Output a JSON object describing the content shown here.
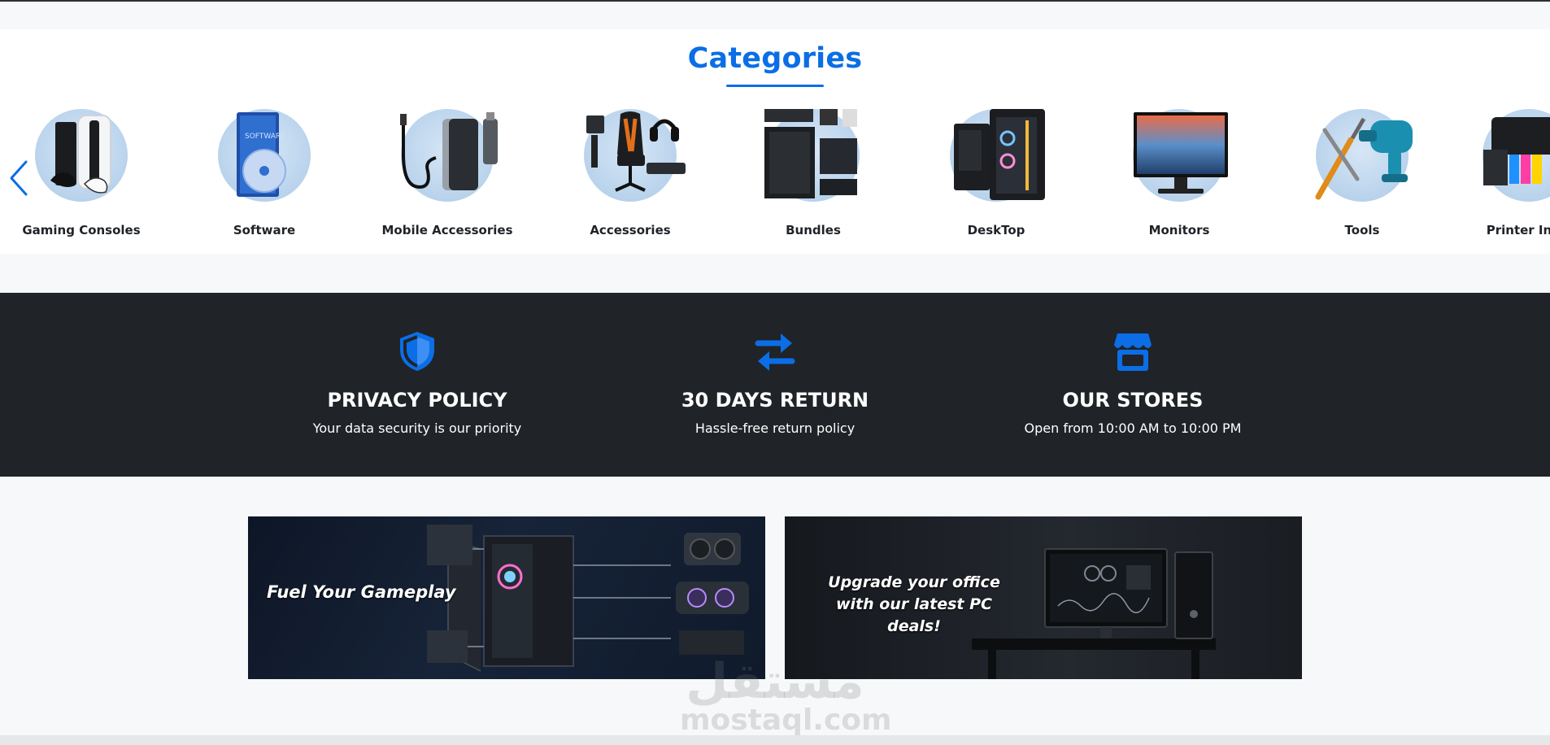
{
  "categories": {
    "title": "Categories",
    "items": [
      {
        "label": "Gaming Consoles",
        "icon": "console-icon"
      },
      {
        "label": "Software",
        "icon": "software-box-icon"
      },
      {
        "label": "Mobile Accessories",
        "icon": "powerbank-icon"
      },
      {
        "label": "Accessories",
        "icon": "gaming-chair-icon"
      },
      {
        "label": "Bundles",
        "icon": "pc-parts-icon"
      },
      {
        "label": "DeskTop",
        "icon": "desktop-tower-icon"
      },
      {
        "label": "Monitors",
        "icon": "monitor-icon"
      },
      {
        "label": "Tools",
        "icon": "tools-icon"
      },
      {
        "label": "Printer Ink c",
        "icon": "printer-ink-icon"
      }
    ]
  },
  "features": [
    {
      "title": "PRIVACY POLICY",
      "subtitle": "Your data security is our priority",
      "icon": "shield-icon"
    },
    {
      "title": "30 DAYS RETURN",
      "subtitle": "Hassle-free return policy",
      "icon": "swap-arrows-icon"
    },
    {
      "title": "OUR STORES",
      "subtitle": "Open from 10:00 AM to 10:00 PM",
      "icon": "store-icon"
    }
  ],
  "banners": [
    {
      "lines": [
        "Fuel Your Gameplay"
      ]
    },
    {
      "lines": [
        "Upgrade your office",
        "with our latest PC deals!"
      ]
    }
  ],
  "watermark": {
    "arabic": "مستقل",
    "latin": "mostaql.com"
  },
  "colors": {
    "accent": "#0b6ee6",
    "dark": "#202328",
    "background": "#f7f8fa"
  }
}
